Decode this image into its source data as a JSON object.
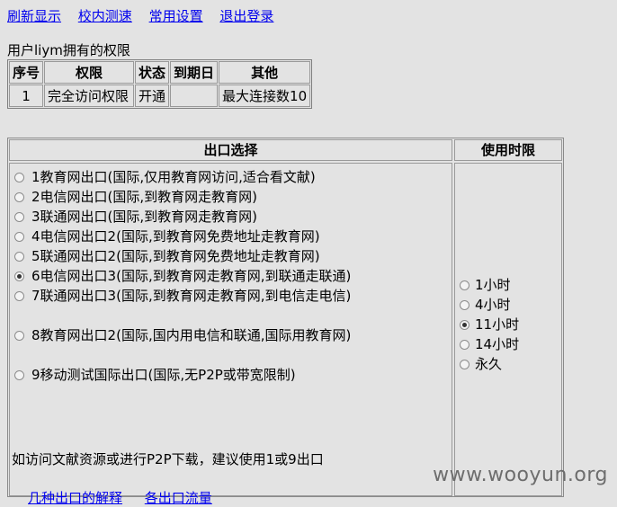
{
  "nav": {
    "refresh": "刷新显示",
    "speedtest": "校内测速",
    "settings": "常用设置",
    "logout": "退出登录"
  },
  "user_line": "用户liym拥有的权限",
  "perm_table": {
    "headers": [
      "序号",
      "权限",
      "状态",
      "到期日",
      "其他"
    ],
    "rows": [
      [
        "1",
        "完全访问权限",
        "开通",
        "",
        "最大连接数10"
      ]
    ]
  },
  "exit_header": "出口选择",
  "time_header": "使用时限",
  "exits": [
    {
      "label": "1教育网出口(国际,仅用教育网访问,适合看文献)",
      "checked": false
    },
    {
      "label": "2电信网出口(国际,到教育网走教育网)",
      "checked": false
    },
    {
      "label": "3联通网出口(国际,到教育网走教育网)",
      "checked": false
    },
    {
      "label": "4电信网出口2(国际,到教育网免费地址走教育网)",
      "checked": false
    },
    {
      "label": "5联通网出口2(国际,到教育网免费地址走教育网)",
      "checked": false
    },
    {
      "label": "6电信网出口3(国际,到教育网走教育网,到联通走联通)",
      "checked": true
    },
    {
      "label": "7联通网出口3(国际,到教育网走教育网,到电信走电信)",
      "checked": false
    },
    {
      "label": "8教育网出口2(国际,国内用电信和联通,国际用教育网)",
      "checked": false
    },
    {
      "label": "9移动测试国际出口(国际,无P2P或带宽限制)",
      "checked": false
    }
  ],
  "times": [
    {
      "label": "1小时",
      "checked": false
    },
    {
      "label": "4小时",
      "checked": false
    },
    {
      "label": "11小时",
      "checked": true
    },
    {
      "label": "14小时",
      "checked": false
    },
    {
      "label": "永久",
      "checked": false
    }
  ],
  "note": "如访问文献资源或进行P2P下载，建议使用1或9出口",
  "links": {
    "explain": "几种出口的解释",
    "traffic": "各出口流量"
  },
  "watermark": "www.wooyun.org"
}
